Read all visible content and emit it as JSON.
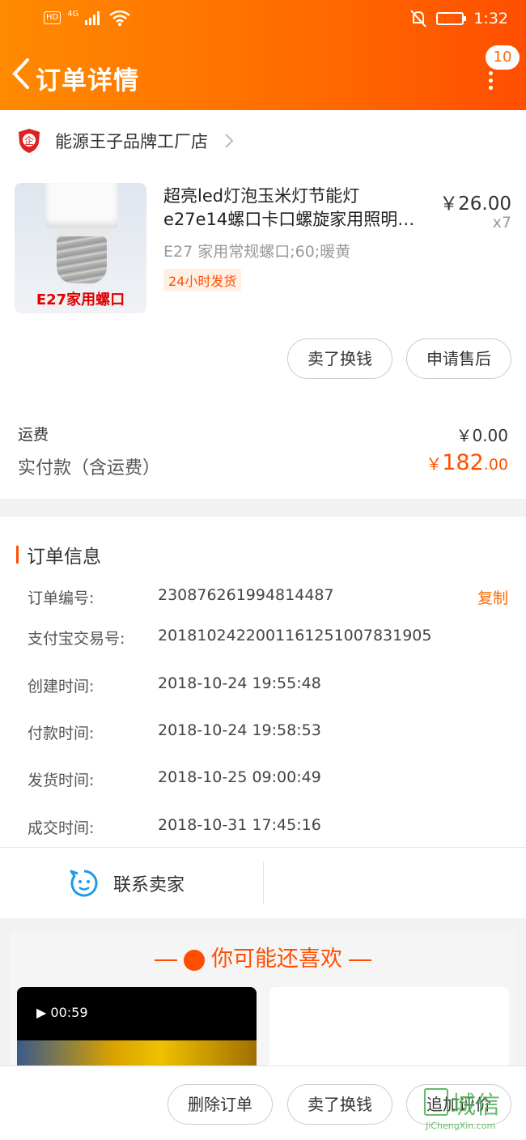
{
  "status_bar": {
    "hd": "HD",
    "net": "4G",
    "time": "1:32"
  },
  "header": {
    "title": "订单详情",
    "badge": "10"
  },
  "shop": {
    "icon_text": "企",
    "name": "能源王子品牌工厂店"
  },
  "product": {
    "title_line1": "超亮led灯泡玉米灯节能灯",
    "title_line2": "e27e14螺口卡口螺旋家用照明…",
    "price": "￥26.00",
    "qty": "x7",
    "sku": "E27 家用常规螺口;60;暖黄",
    "tag": "24小时发货",
    "thumb_label": "E27家用螺口"
  },
  "item_actions": {
    "sell": "卖了换钱",
    "after_sale": "申请售后"
  },
  "totals": {
    "shipping_label": "运费",
    "shipping_value": "￥0.00",
    "paid_label": "实付款（含运费）",
    "paid_currency": "￥",
    "paid_int": "182",
    "paid_dec": ".00"
  },
  "order_info": {
    "section_title": "订单信息",
    "copy": "复制",
    "rows": [
      {
        "label": "订单编号:",
        "value": "230876261994814487"
      },
      {
        "label": "支付宝交易号:",
        "value": "2018102422001161251007831905"
      },
      {
        "label": "创建时间:",
        "value": "2018-10-24 19:55:48"
      },
      {
        "label": "付款时间:",
        "value": "2018-10-24 19:58:53"
      },
      {
        "label": "发货时间:",
        "value": "2018-10-25 09:00:49"
      },
      {
        "label": "成交时间:",
        "value": "2018-10-31 17:45:16"
      }
    ]
  },
  "contact": {
    "label": "联系卖家"
  },
  "recommend": {
    "title": "你可能还喜欢",
    "video_time": "00:59"
  },
  "bottom_actions": {
    "delete": "删除订单",
    "sell": "卖了换钱",
    "review": "追加评价"
  },
  "watermark": {
    "text": "城信",
    "url": "JiChengXin.com"
  },
  "colors": {
    "accent": "#ff5000",
    "header_start": "#ff8a00",
    "header_end": "#ff4e00"
  }
}
